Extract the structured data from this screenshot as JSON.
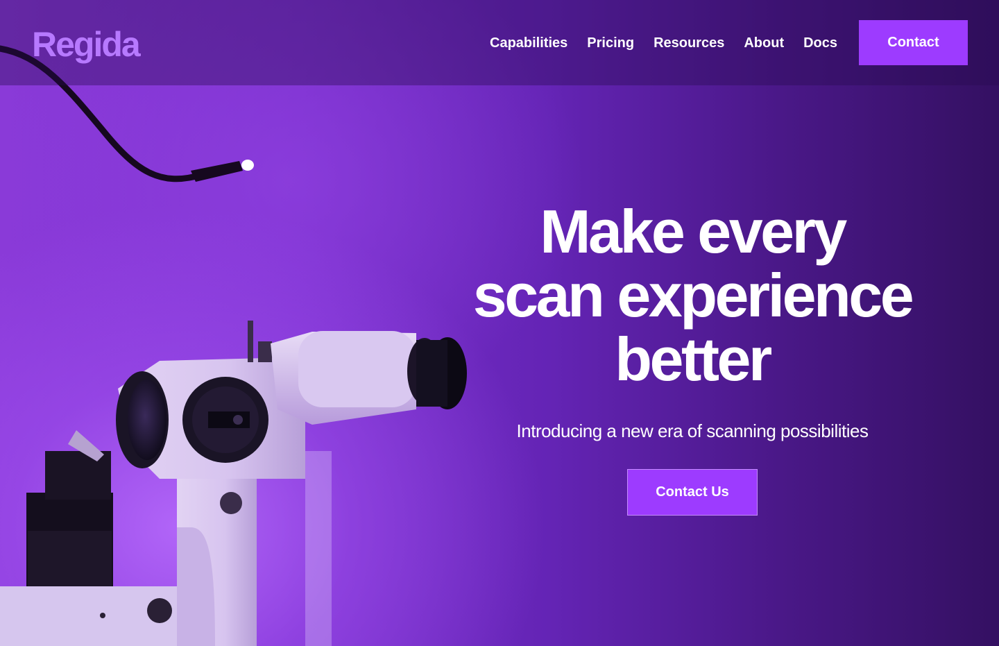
{
  "brand": {
    "name": "Regida",
    "logo_color": "#b779ff",
    "accent": "#9d3bff"
  },
  "nav": {
    "links": [
      "Capabilities",
      "Pricing",
      "Resources",
      "About",
      "Docs"
    ],
    "contact_label": "Contact"
  },
  "hero": {
    "headline_lines": [
      "Make every",
      "scan experience",
      "better"
    ],
    "subtitle": "Introducing a new era of scanning possibilities",
    "cta_label": "Contact Us",
    "image": "slit-lamp-microscope-photo"
  }
}
